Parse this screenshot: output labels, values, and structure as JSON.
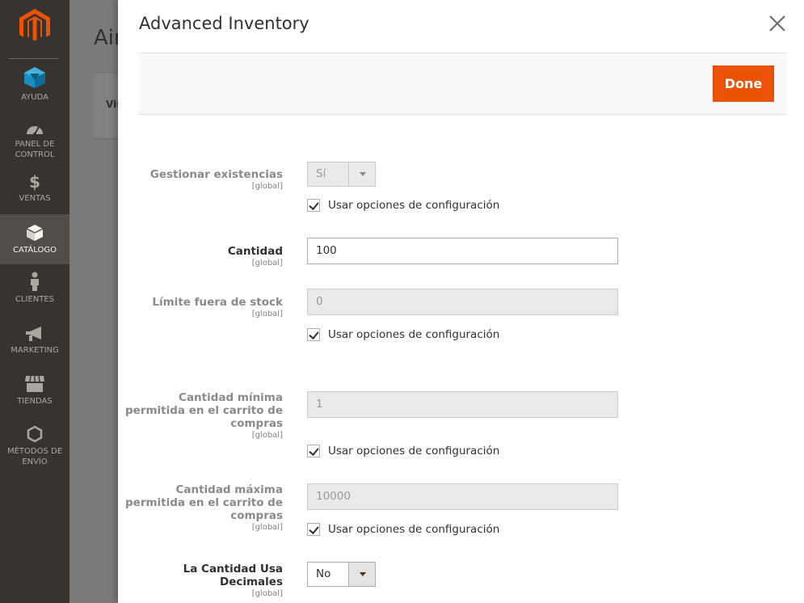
{
  "sidebar": {
    "items": [
      {
        "label": "AYUDA",
        "icon": "cube-icon"
      },
      {
        "label": "PANEL DE CONTROL",
        "icon": "dashboard-icon"
      },
      {
        "label": "VENTAS",
        "icon": "dollar-icon"
      },
      {
        "label": "CATÁLOGO",
        "icon": "box-icon"
      },
      {
        "label": "CLIENTES",
        "icon": "person-icon"
      },
      {
        "label": "MARKETING",
        "icon": "megaphone-icon"
      },
      {
        "label": "TIENDAS",
        "icon": "store-icon"
      },
      {
        "label": "MÉTODOS DE ENVÍO",
        "icon": "hexagon-icon"
      }
    ],
    "active": "CATÁLOGO"
  },
  "background": {
    "title": "Air",
    "box_text": "Vis"
  },
  "modal": {
    "title": "Advanced Inventory",
    "done_label": "Done"
  },
  "form": {
    "manage_stock": {
      "label": "Gestionar existencias",
      "scope": "[global]",
      "value": "Sí",
      "use_config": "Usar opciones de configuración"
    },
    "qty": {
      "label": "Cantidad",
      "scope": "[global]",
      "value": "100"
    },
    "out_of_stock": {
      "label": "Límite fuera de stock",
      "scope": "[global]",
      "value": "0",
      "use_config": "Usar opciones de configuración"
    },
    "min_qty": {
      "label": "Cantidad mínima permitida en el carrito de compras",
      "scope": "[global]",
      "value": "1",
      "use_config": "Usar opciones de configuración"
    },
    "max_qty": {
      "label": "Cantidad máxima permitida en el carrito de compras",
      "scope": "[global]",
      "value": "10000",
      "use_config": "Usar opciones de configuración"
    },
    "decimals": {
      "label": "La Cantidad Usa Decimales",
      "scope": "[global]",
      "value": "No"
    }
  },
  "colors": {
    "sidebar_bg": "#373330",
    "accent": "#eb5202",
    "logo": "#eb5202"
  }
}
